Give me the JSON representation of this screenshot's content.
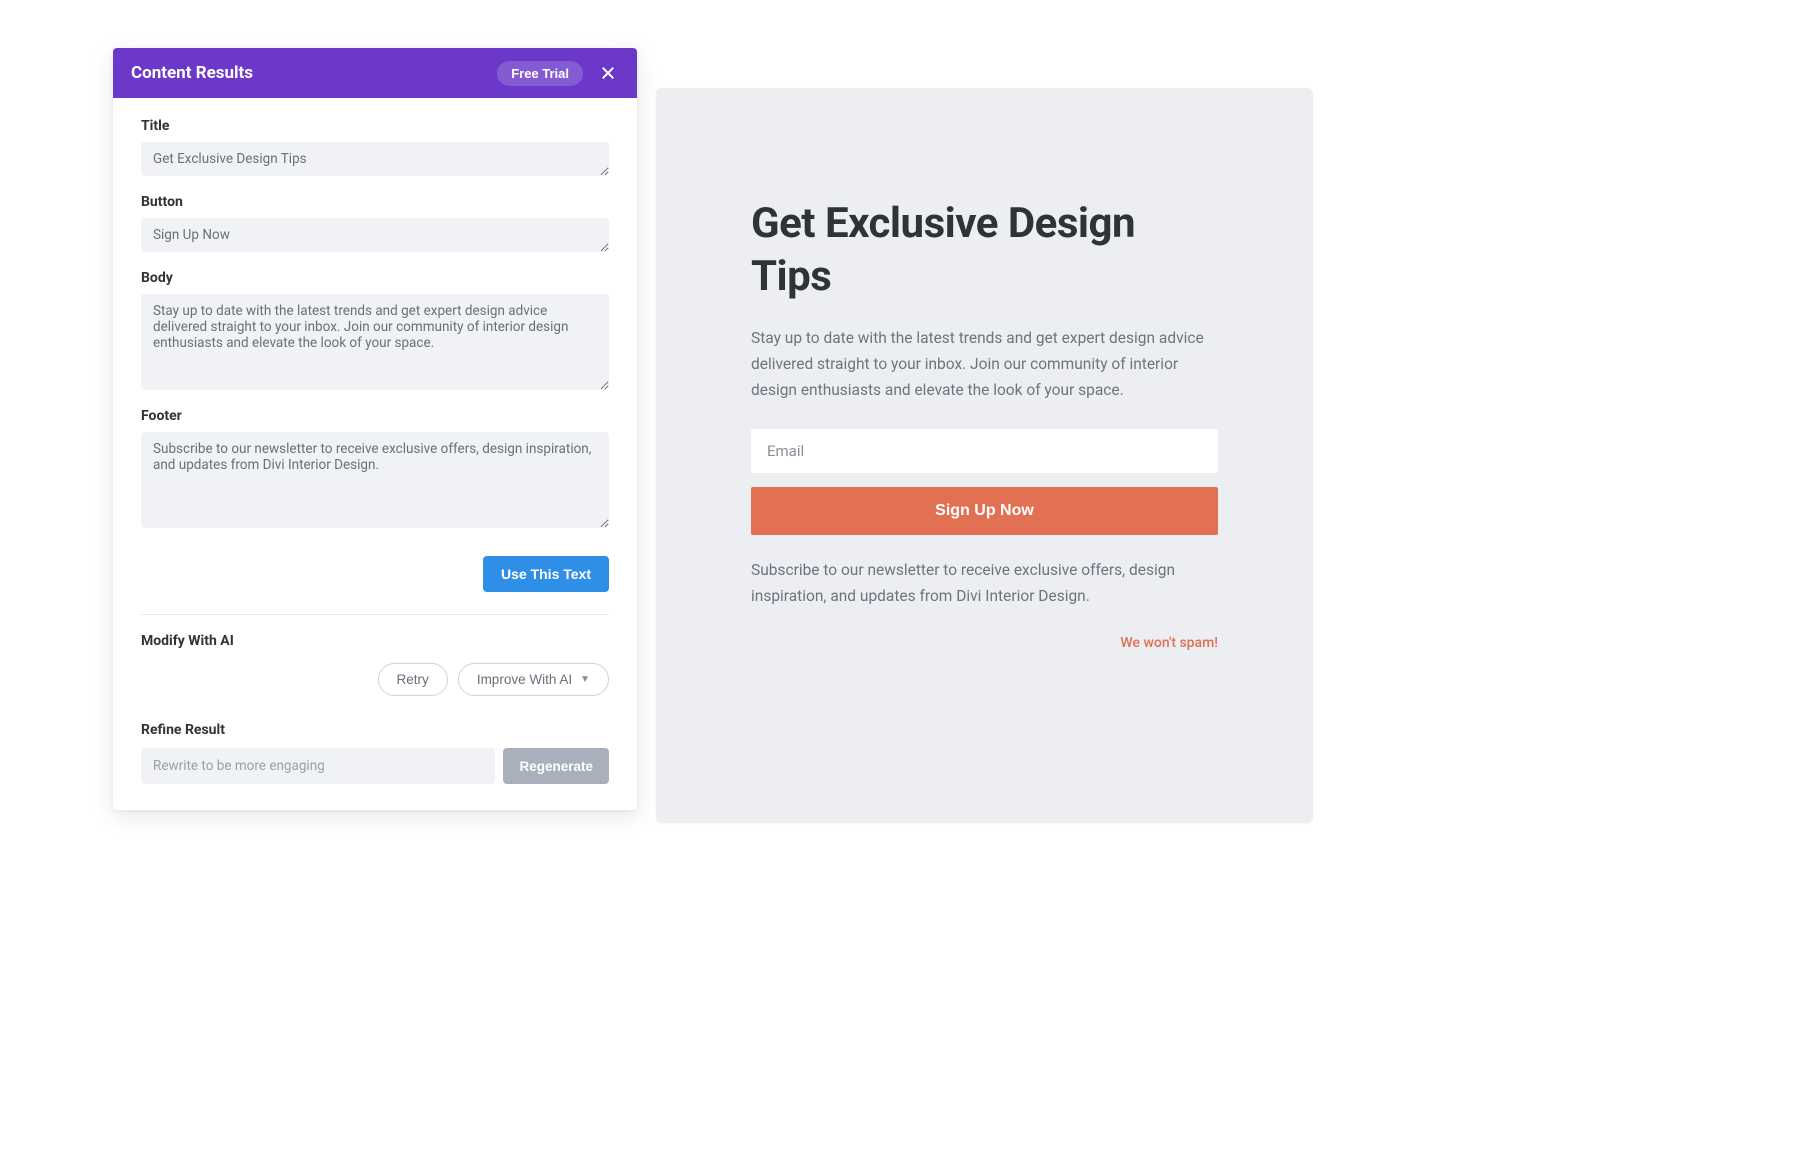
{
  "panel": {
    "header_title": "Content Results",
    "free_trial": "Free Trial",
    "labels": {
      "title": "Title",
      "button": "Button",
      "body": "Body",
      "footer": "Footer",
      "modify": "Modify With AI",
      "refine": "Refine Result"
    },
    "values": {
      "title": "Get Exclusive Design Tips",
      "button": "Sign Up Now",
      "body": "Stay up to date with the latest trends and get expert design advice delivered straight to your inbox. Join our community of interior design enthusiasts and elevate the look of your space.",
      "footer": "Subscribe to our newsletter to receive exclusive offers, design inspiration, and updates from Divi Interior Design."
    },
    "buttons": {
      "use_text": "Use This Text",
      "retry": "Retry",
      "improve": "Improve With AI",
      "regenerate": "Regenerate"
    },
    "refine_placeholder": "Rewrite to be more engaging"
  },
  "preview": {
    "title": "Get Exclusive Design Tips",
    "body": "Stay up to date with the latest trends and get expert design advice delivered straight to your inbox. Join our community of interior design enthusiasts and elevate the look of your space.",
    "email_placeholder": "Email",
    "cta": "Sign Up Now",
    "footer": "Subscribe to our newsletter to receive exclusive offers, design inspiration, and updates from Divi Interior Design.",
    "spam_notice": "We won't spam!"
  }
}
